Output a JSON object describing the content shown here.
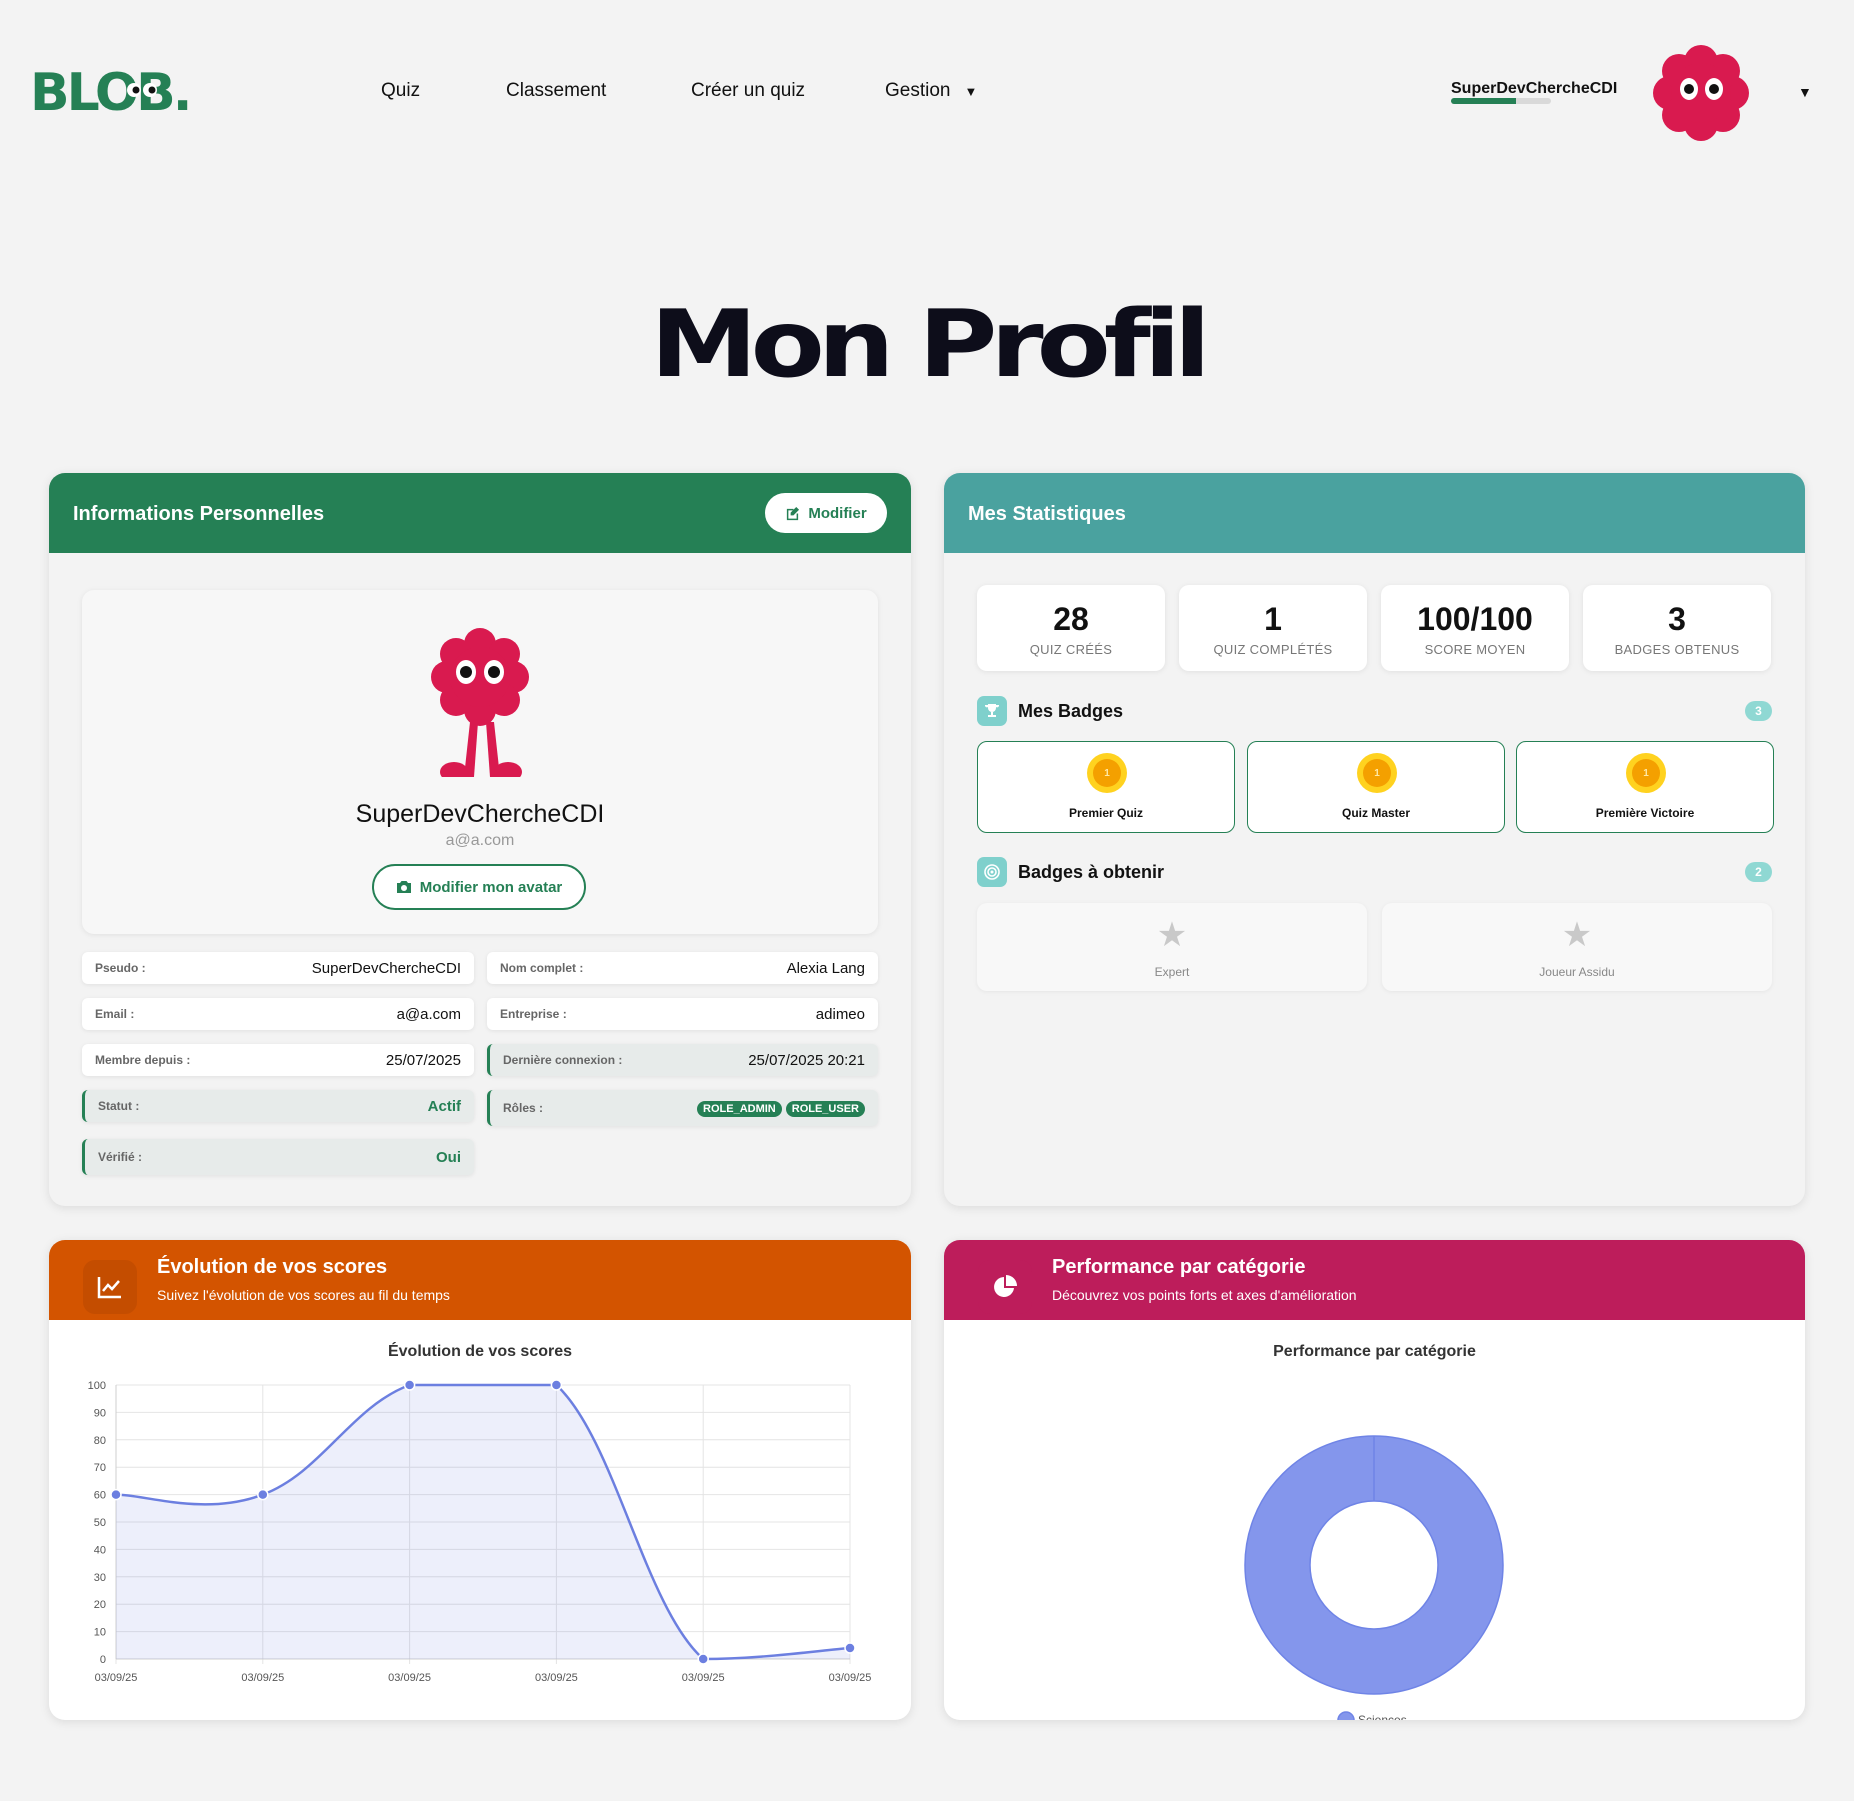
{
  "nav": {
    "logo_text": "BLOB.",
    "links": [
      "Quiz",
      "Classement",
      "Créer un quiz",
      "Gestion"
    ],
    "gestion_caret": "▼",
    "user_name": "SuperDevChercheCDI",
    "xp_progress": 0.65,
    "user_caret": "▼"
  },
  "page": {
    "title": "Mon Profil"
  },
  "personal": {
    "header_title": "Informations Personnelles",
    "edit_button": "Modifier",
    "username": "SuperDevChercheCDI",
    "email": "a@a.com",
    "avatar_button": "Modifier mon avatar",
    "fields": {
      "pseudo_label": "Pseudo :",
      "pseudo_value": "SuperDevChercheCDI",
      "fullname_label": "Nom complet :",
      "fullname_value": "Alexia Lang",
      "email_label": "Email :",
      "email_value": "a@a.com",
      "company_label": "Entreprise :",
      "company_value": "adimeo",
      "member_label": "Membre depuis :",
      "member_value": "25/07/2025",
      "lastlogin_label": "Dernière connexion :",
      "lastlogin_value": "25/07/2025 20:21",
      "status_label": "Statut :",
      "status_value": "Actif",
      "roles_label": "Rôles :",
      "roles": [
        "ROLE_ADMIN",
        "ROLE_USER"
      ],
      "verified_label": "Vérifié :",
      "verified_value": "Oui"
    }
  },
  "stats": {
    "header_title": "Mes Statistiques",
    "boxes": [
      {
        "num": "28",
        "label": "QUIZ CRÉÉS"
      },
      {
        "num": "1",
        "label": "QUIZ COMPLÉTÉS"
      },
      {
        "num": "100/100",
        "label": "SCORE MOYEN"
      },
      {
        "num": "3",
        "label": "BADGES OBTENUS"
      }
    ],
    "badges_title": "Mes Badges",
    "badges_count": "3",
    "badges": [
      {
        "name": "Premier Quiz",
        "medal": "1"
      },
      {
        "name": "Quiz Master",
        "medal": "1"
      },
      {
        "name": "Première Victoire",
        "medal": "1"
      }
    ],
    "locked_title": "Badges à obtenir",
    "locked_count": "2",
    "locked": [
      {
        "name": "Expert"
      },
      {
        "name": "Joueur Assidu"
      }
    ]
  },
  "score_chart": {
    "header_title": "Évolution de vos scores",
    "header_sub": "Suivez l'évolution de vos scores au fil du temps",
    "color": "#d35400"
  },
  "category_chart": {
    "header_title": "Performance par catégorie",
    "header_sub": "Découvrez vos points forts et axes d'amélioration",
    "color": "#bd1d5b"
  },
  "chart_data": [
    {
      "type": "area",
      "title": "Évolution de vos scores",
      "categories": [
        "03/09/25",
        "03/09/25",
        "03/09/25",
        "03/09/25",
        "03/09/25",
        "03/09/25"
      ],
      "values": [
        60,
        60,
        100,
        100,
        0,
        4
      ],
      "yticks": [
        "0",
        "10",
        "20",
        "30",
        "40",
        "50",
        "60",
        "70",
        "80",
        "90",
        "100"
      ],
      "ylim": [
        0,
        100
      ],
      "grid": true,
      "color": "#6c7fe0"
    },
    {
      "type": "pie",
      "title": "Performance par catégorie",
      "labels": [
        "Sciences"
      ],
      "values": [
        100
      ],
      "donut": true,
      "legend": "bottom",
      "color": "#8496ec"
    }
  ]
}
